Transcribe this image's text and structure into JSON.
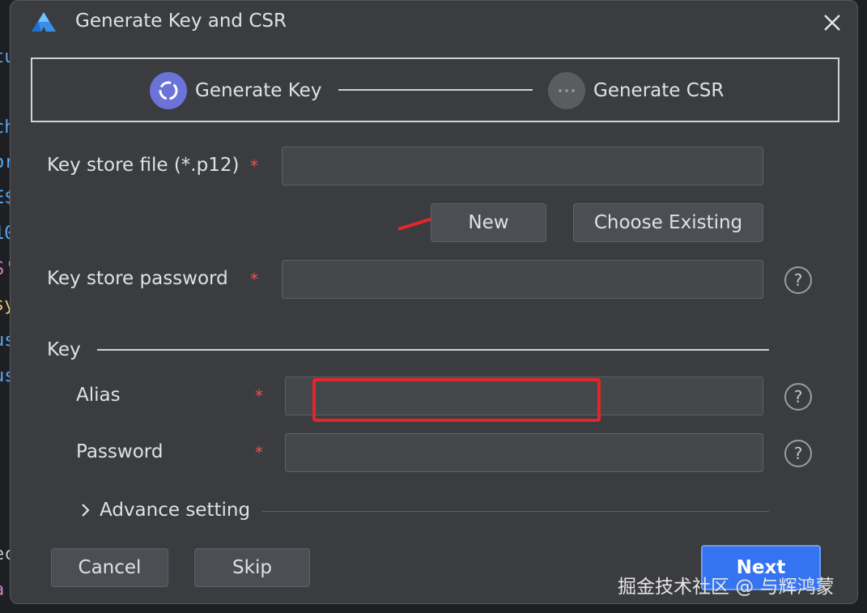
{
  "background_code": {
    "fragments": [
      "tu",
      "ch",
      "or",
      "E$",
      "10",
      "S'",
      "sy",
      "us",
      "us",
      "ec",
      "a"
    ]
  },
  "dialog": {
    "title": "Generate Key and CSR",
    "icons": {
      "logo": "huawei-deveco-logo",
      "close": "close-icon"
    }
  },
  "steps": [
    {
      "label": "Generate Key",
      "state": "active"
    },
    {
      "label": "Generate CSR",
      "state": "pending"
    }
  ],
  "form": {
    "keystore_file": {
      "label": "Key store file (*.p12)",
      "required": "*",
      "value": "",
      "placeholder": ""
    },
    "new_button": "New",
    "choose_existing_button": "Choose Existing",
    "keystore_password": {
      "label": "Key store password",
      "required": "*",
      "value": ""
    },
    "key_section": "Key",
    "alias": {
      "label": "Alias",
      "required": "*",
      "value": ""
    },
    "password": {
      "label": "Password",
      "required": "*",
      "value": ""
    },
    "advance_setting": "Advance setting",
    "help_icon_glyph": "?"
  },
  "footer": {
    "cancel": "Cancel",
    "skip": "Skip",
    "next": "Next"
  },
  "annotations": {
    "arrow_color": "#e3262b",
    "highlight_color": "#e3262b"
  },
  "watermark": "掘金技术社区 @ 与辉鸿蒙",
  "colors": {
    "accent": "#6b73d8",
    "primary_button": "#3574f0",
    "required_star": "#e0555a",
    "dialog_bg": "#3b3c3f"
  }
}
